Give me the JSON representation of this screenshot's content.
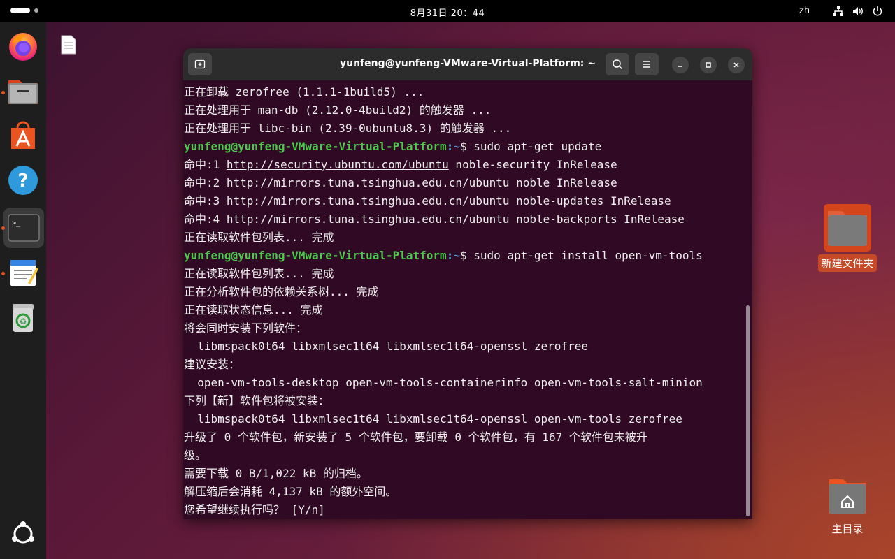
{
  "topbar": {
    "clock": "8月31日  20：44",
    "language": "zh"
  },
  "dock": {
    "items": [
      {
        "name": "firefox",
        "icon": "firefox-icon"
      },
      {
        "name": "files",
        "icon": "folder-icon"
      },
      {
        "name": "app-center",
        "icon": "app-center-icon"
      },
      {
        "name": "help",
        "icon": "help-icon"
      },
      {
        "name": "terminal",
        "icon": "terminal-icon"
      },
      {
        "name": "text-editor",
        "icon": "text-editor-icon"
      },
      {
        "name": "trash",
        "icon": "trash-icon"
      },
      {
        "name": "show-apps",
        "icon": "ubuntu-logo-icon"
      }
    ]
  },
  "desktop": {
    "new_folder_label": "新建文件夹",
    "home_label": "主目录"
  },
  "terminal": {
    "title": "yunfeng@yunfeng-VMware-Virtual-Platform: ~",
    "prompt_user": "yunfeng@yunfeng-VMware-Virtual-Platform",
    "prompt_path": ":~",
    "lines": [
      {
        "text": "正在卸载 zerofree (1.1.1-1build5) ..."
      },
      {
        "text": "正在处理用于 man-db (2.12.0-4build2) 的触发器 ..."
      },
      {
        "text": "正在处理用于 libc-bin (2.39-0ubuntu8.3) 的触发器 ..."
      },
      {
        "prompt": true,
        "cmd": "$ sudo apt-get update"
      },
      {
        "pre": "命中:1 ",
        "link": "http://security.ubuntu.com/ubuntu",
        "post": " noble-security InRelease"
      },
      {
        "text": "命中:2 http://mirrors.tuna.tsinghua.edu.cn/ubuntu noble InRelease"
      },
      {
        "text": "命中:3 http://mirrors.tuna.tsinghua.edu.cn/ubuntu noble-updates InRelease"
      },
      {
        "text": "命中:4 http://mirrors.tuna.tsinghua.edu.cn/ubuntu noble-backports InRelease"
      },
      {
        "text": "正在读取软件包列表... 完成"
      },
      {
        "prompt": true,
        "cmd": "$ sudo apt-get install open-vm-tools"
      },
      {
        "text": "正在读取软件包列表... 完成"
      },
      {
        "text": "正在分析软件包的依赖关系树... 完成"
      },
      {
        "text": "正在读取状态信息... 完成"
      },
      {
        "text": "将会同时安装下列软件："
      },
      {
        "text": "  libmspack0t64 libxmlsec1t64 libxmlsec1t64-openssl zerofree"
      },
      {
        "text": "建议安装："
      },
      {
        "text": "  open-vm-tools-desktop open-vm-tools-containerinfo open-vm-tools-salt-minion"
      },
      {
        "text": "下列【新】软件包将被安装："
      },
      {
        "text": "  libmspack0t64 libxmlsec1t64 libxmlsec1t64-openssl open-vm-tools zerofree"
      },
      {
        "text": "升级了 0 个软件包，新安装了 5 个软件包，要卸载 0 个软件包，有 167 个软件包未被升"
      },
      {
        "text": "级。"
      },
      {
        "text": "需要下载 0 B/1,022 kB 的归档。"
      },
      {
        "text": "解压缩后会消耗 4,137 kB 的额外空间。"
      },
      {
        "text": "您希望继续执行吗？ [Y/n]"
      }
    ]
  }
}
